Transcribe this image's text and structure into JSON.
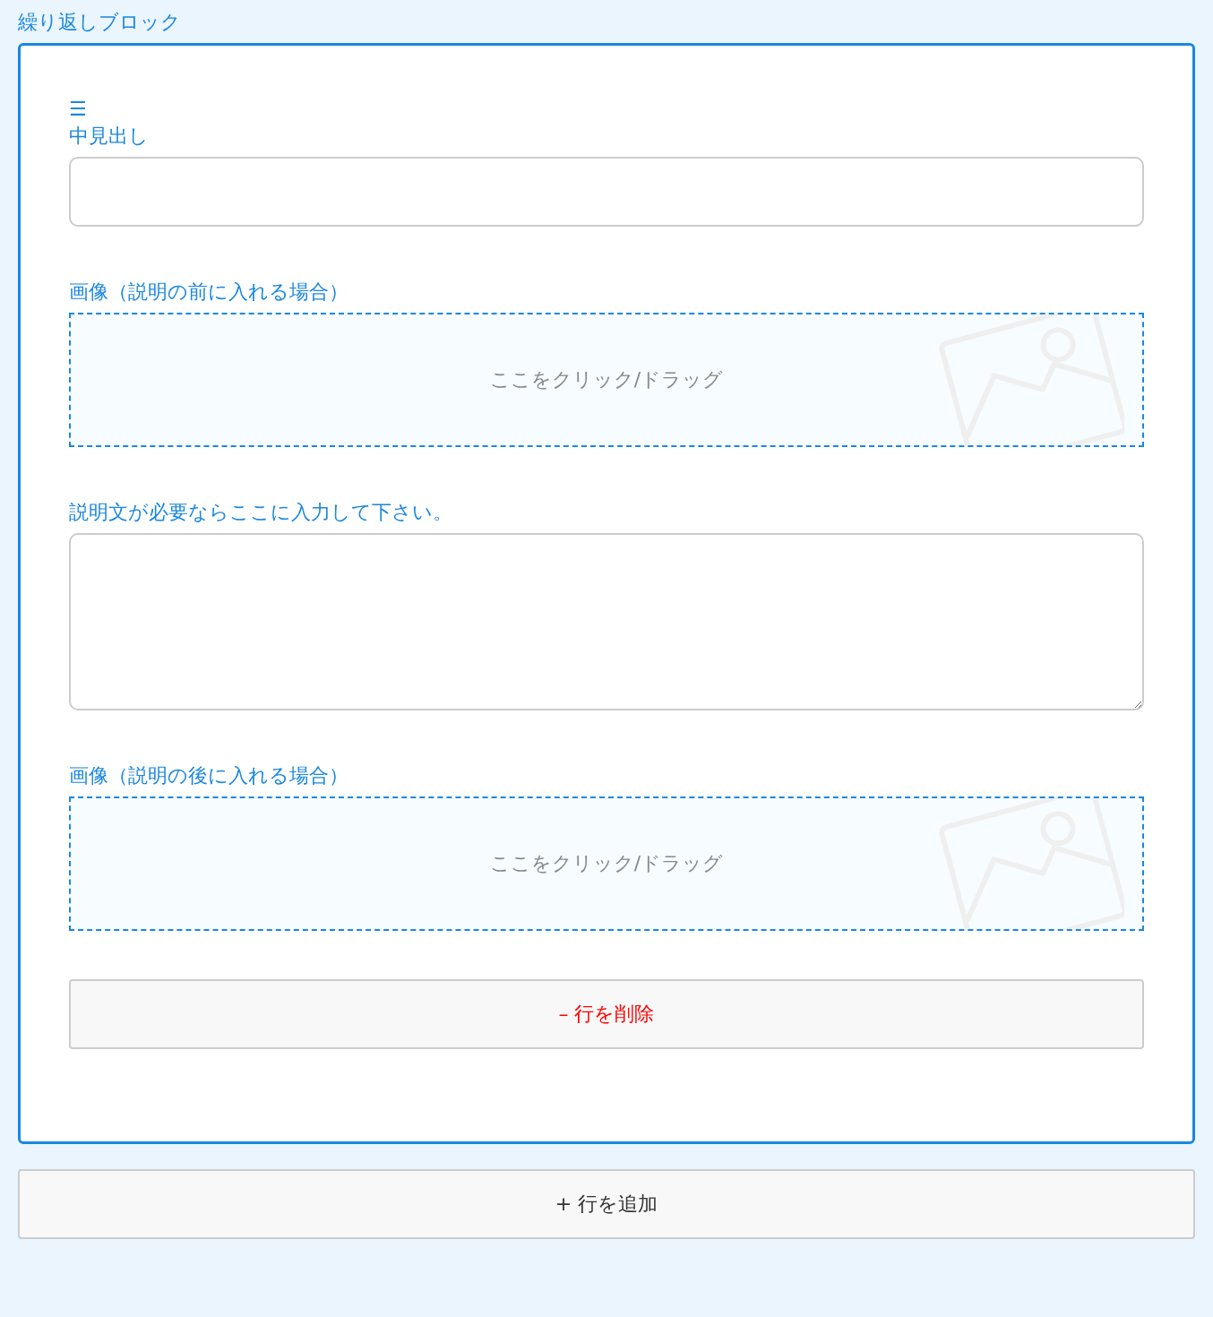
{
  "block_title": "繰り返しブロック",
  "row": {
    "handle": "☰",
    "fields": [
      {
        "kind": "text",
        "label": "中見出し"
      },
      {
        "kind": "image",
        "label": "画像（説明の前に入れる場合）",
        "prompt": "ここをクリック/ドラッグ"
      },
      {
        "kind": "textarea",
        "label": "説明文が必要ならここに入力して下さい。"
      },
      {
        "kind": "image",
        "label": "画像（説明の後に入れる場合）",
        "prompt": "ここをクリック/ドラッグ"
      }
    ],
    "remove_button": "– 行を削除"
  },
  "add_button": "+ 行を追加"
}
